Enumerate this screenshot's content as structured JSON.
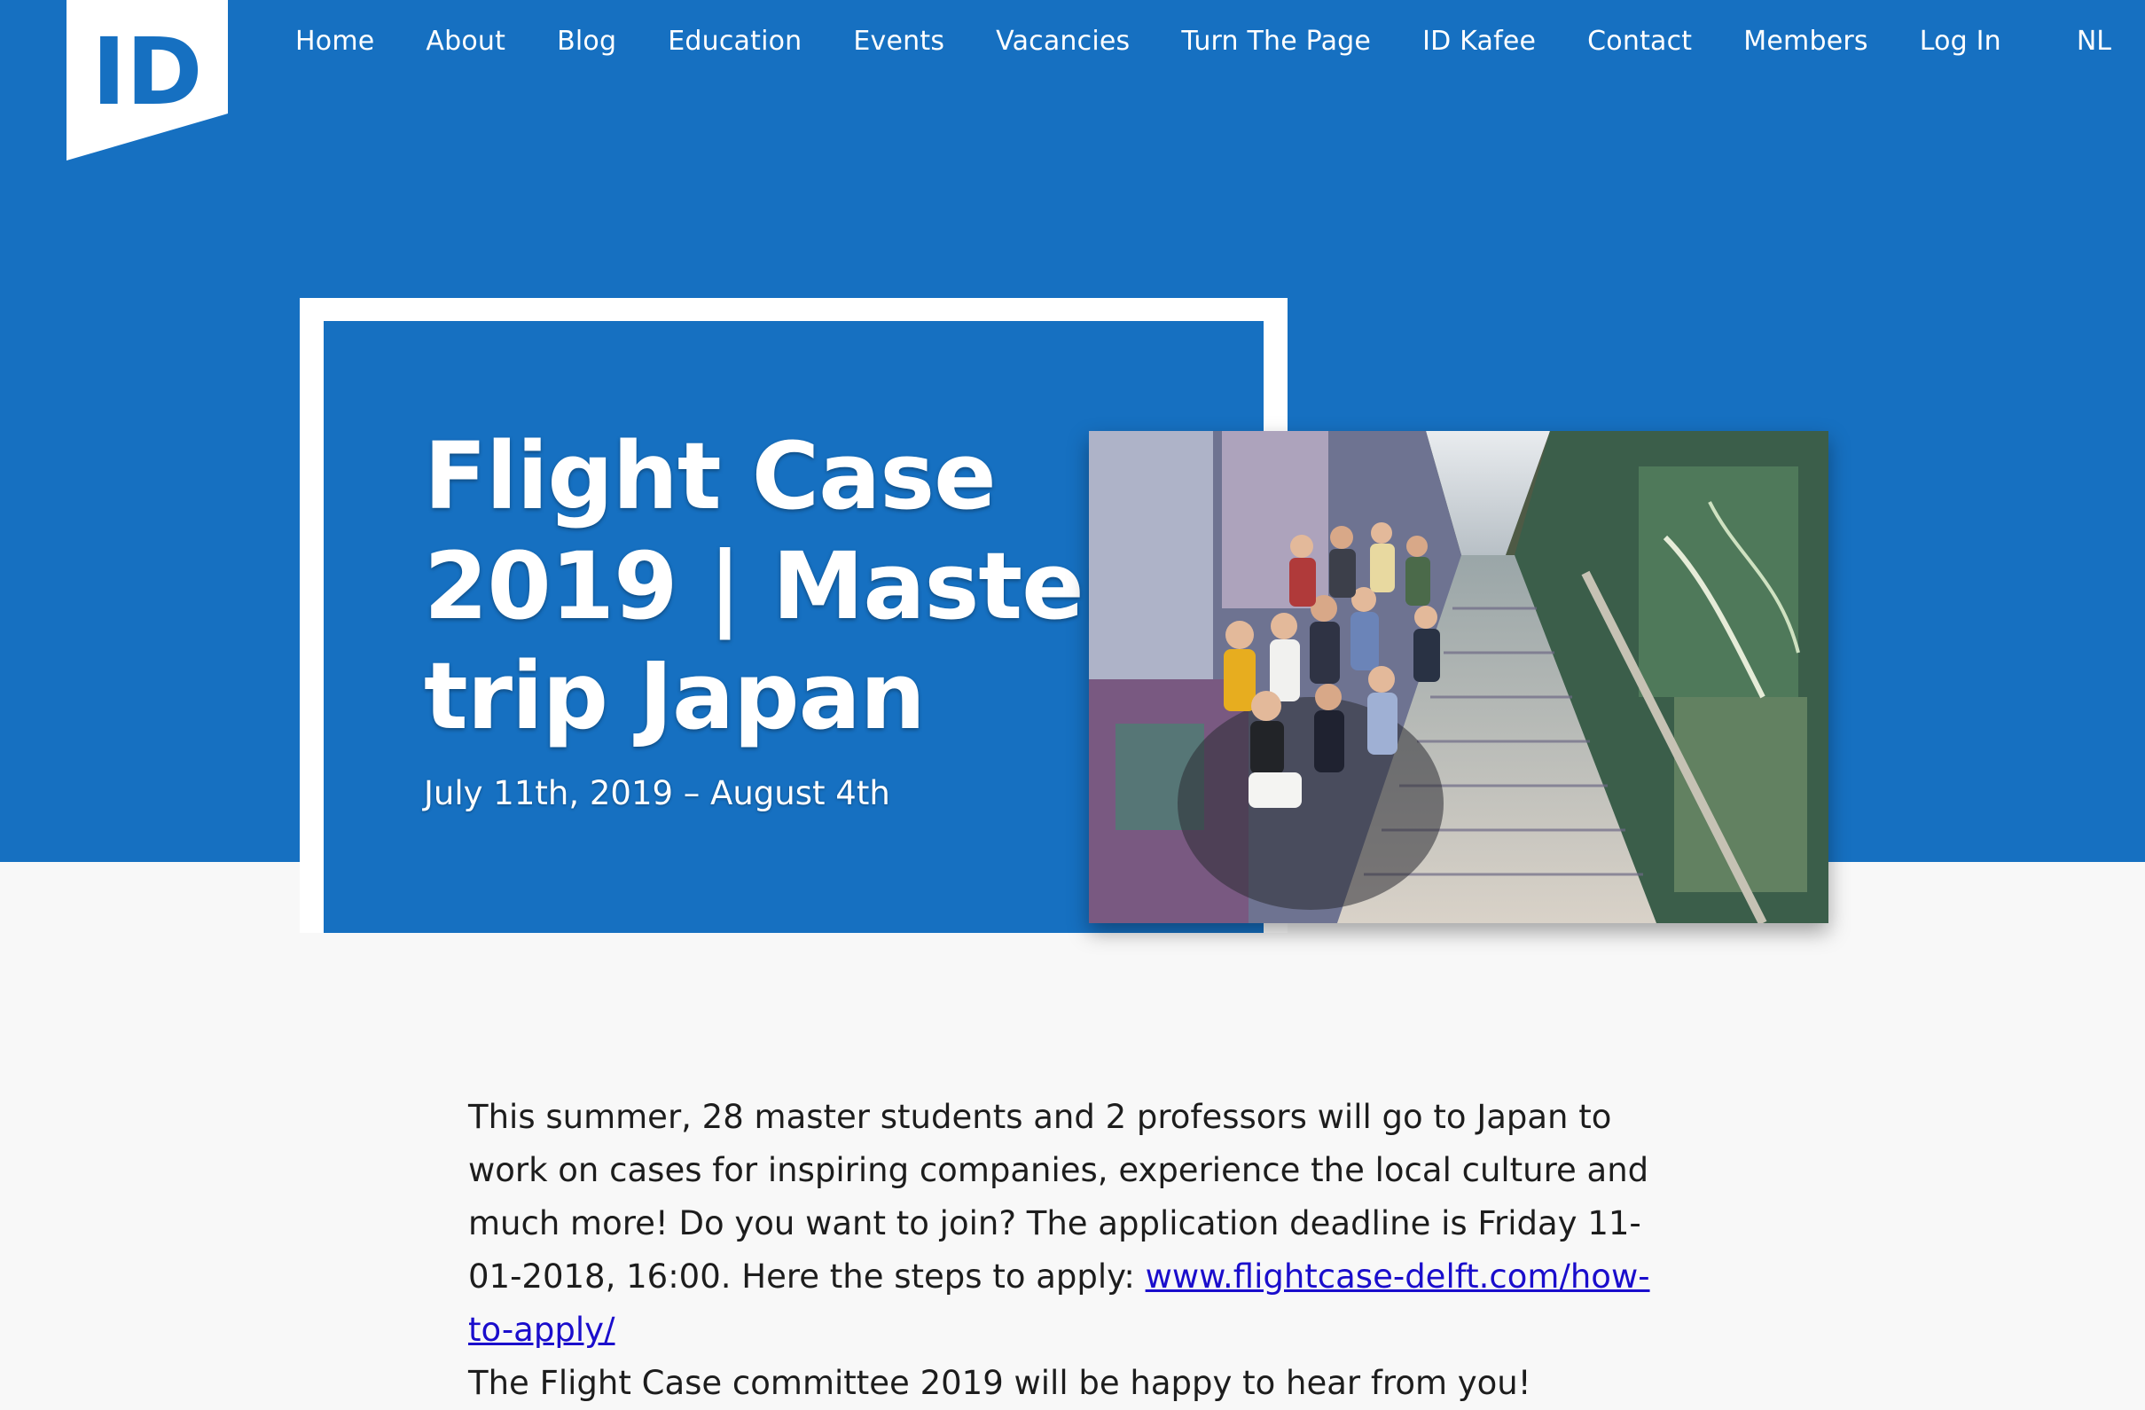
{
  "brand": {
    "logo_text": "ID",
    "colors": {
      "primary_blue": "#1670c1",
      "page_background": "#f8f8f8",
      "white": "#ffffff",
      "link": "#1a0dcc",
      "body_text": "#1d1d1d"
    }
  },
  "nav": {
    "items": [
      {
        "label": "Home"
      },
      {
        "label": "About"
      },
      {
        "label": "Blog"
      },
      {
        "label": "Education"
      },
      {
        "label": "Events"
      },
      {
        "label": "Vacancies"
      },
      {
        "label": "Turn The Page"
      },
      {
        "label": "ID Kafee"
      },
      {
        "label": "Contact"
      },
      {
        "label": "Members"
      },
      {
        "label": "Log In"
      }
    ],
    "language": "NL"
  },
  "hero": {
    "title": "Flight Case\n2019 | Master\ntrip Japan",
    "date": "July 11th, 2019 – August 4th",
    "photo_icon": "group-photo-on-graffiti-stairs"
  },
  "article": {
    "intro": "This summer, 28 master students and 2 professors will go to Japan to work on cases for inspiring companies, experience the local culture and much more! Do you want to join? The application deadline is Friday 11-01-2018, 16:00. Here the steps to apply: ",
    "link_text": "www.flightcase-delft.com/how-to-apply/",
    "closing": "The Flight Case committee 2019 will be happy to hear from you!"
  }
}
